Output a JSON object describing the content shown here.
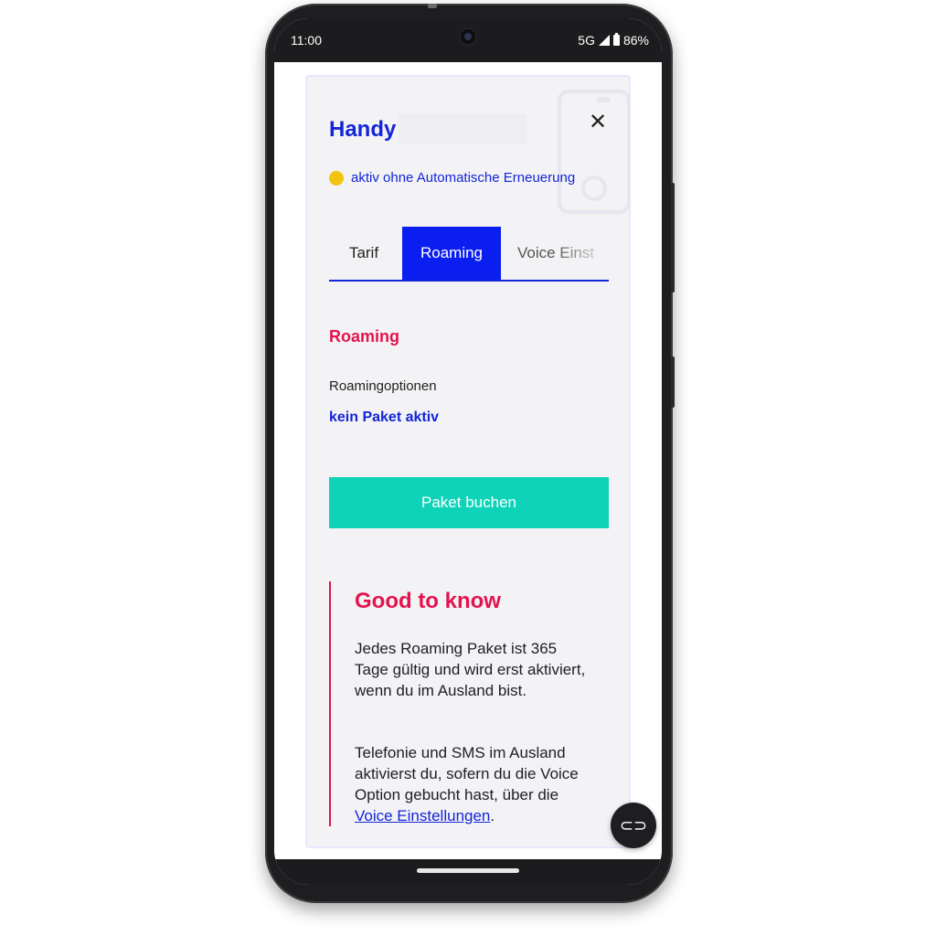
{
  "statusbar": {
    "time": "11:00",
    "network": "5G",
    "battery": "86%",
    "icons": [
      "camera-icon",
      "signal-icon",
      "battery-icon"
    ]
  },
  "header": {
    "title": "Handy",
    "status_text": "aktiv ohne Automatische Erneuerung",
    "status_color": "#f1c40f",
    "close_icon": "close-icon"
  },
  "tabs": [
    {
      "label": "Tarif",
      "active": false
    },
    {
      "label": "Roaming",
      "active": true
    },
    {
      "label": "Voice Einst",
      "active": false
    }
  ],
  "roaming": {
    "section_title": "Roaming",
    "option_label": "Roamingoptionen",
    "option_value": "kein Paket aktiv",
    "book_button": "Paket buchen"
  },
  "info": {
    "title": "Good to know",
    "paragraph1": "Jedes Roaming Paket ist 365 Tage gültig und wird erst aktiviert, wenn du im Ausland bist.",
    "paragraph2_text": "Telefonie und SMS im Ausland aktivierst du, sofern du die Voice Option gebucht hast, über die",
    "paragraph2_link": "Voice Einstellungen",
    "paragraph2_end": "."
  },
  "chat": {
    "icon": "chat-icon",
    "glyph": "⊂⊃"
  },
  "colors": {
    "brand_blue": "#1325d8",
    "accent_pink": "#e3134f",
    "button_teal": "#0fd3b8",
    "tab_active": "#0a1ef0"
  }
}
